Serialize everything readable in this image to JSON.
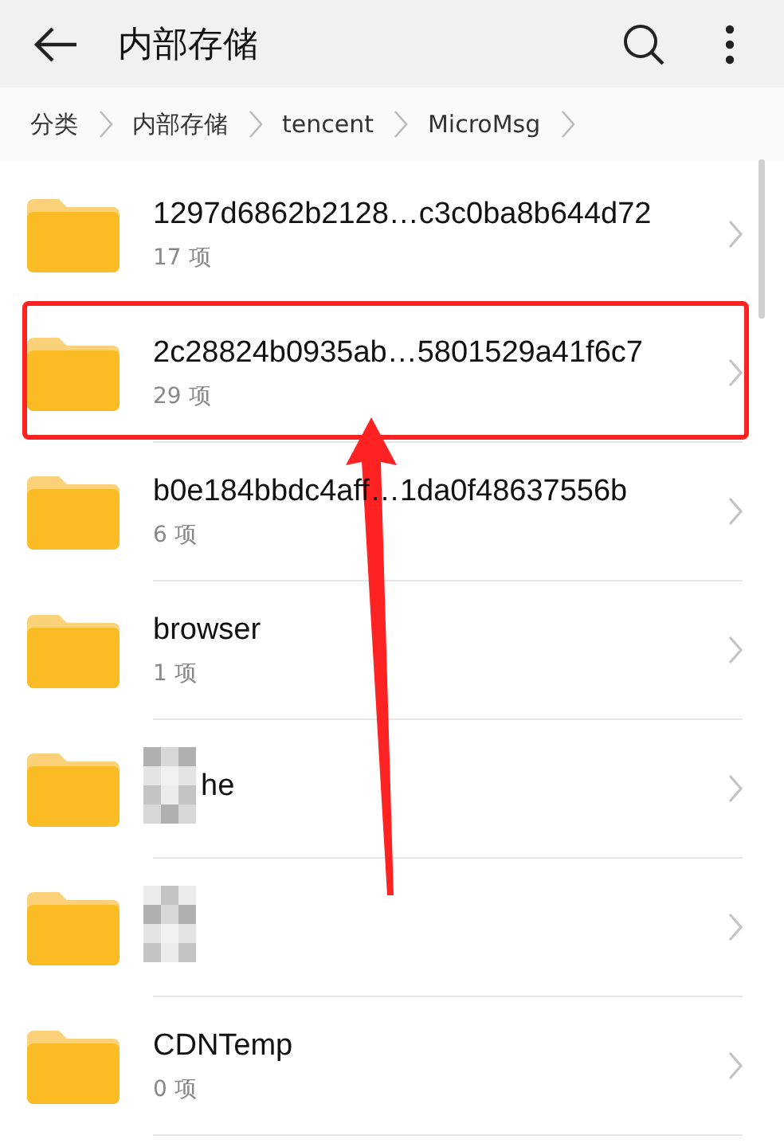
{
  "toolbar": {
    "title": "内部存储"
  },
  "breadcrumb": [
    "分类",
    "内部存储",
    "tencent",
    "MicroMsg"
  ],
  "folders": [
    {
      "name": "1297d6862b2128…c3c0ba8b644d72",
      "count": "17 项",
      "highlighted": false,
      "redacted": false
    },
    {
      "name": "2c28824b0935ab…5801529a41f6c7",
      "count": "29 项",
      "highlighted": true,
      "redacted": false
    },
    {
      "name": "b0e184bbdc4aff…1da0f48637556b",
      "count": "6 项",
      "highlighted": false,
      "redacted": false
    },
    {
      "name": "browser",
      "count": "1 项",
      "highlighted": false,
      "redacted": false
    },
    {
      "name": "he",
      "highlighted": false,
      "redacted": true
    },
    {
      "highlighted": false,
      "redacted": true
    },
    {
      "name": "CDNTemp",
      "count": "0 项",
      "highlighted": false,
      "redacted": false
    }
  ]
}
